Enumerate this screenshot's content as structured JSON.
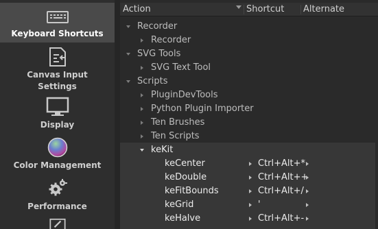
{
  "sidebar": {
    "items": [
      {
        "label": "Keyboard Shortcuts",
        "icon": "keyboard-icon",
        "active": true
      },
      {
        "label": "Canvas Input Settings",
        "icon": "canvas-input-icon",
        "active": false
      },
      {
        "label": "Display",
        "icon": "monitor-icon",
        "active": false
      },
      {
        "label": "Color Management",
        "icon": "color-wheel-icon",
        "active": false
      },
      {
        "label": "Performance",
        "icon": "gears-icon",
        "active": false
      },
      {
        "label": "",
        "icon": "pencil-icon",
        "active": false
      }
    ]
  },
  "table": {
    "columns": {
      "action": "Action",
      "shortcut": "Shortcut",
      "alternate": "Alternate"
    },
    "rows": [
      {
        "text": "Recorder"
      },
      {
        "text": "Recorder"
      },
      {
        "text": "SVG Tools"
      },
      {
        "text": "SVG Text Tool"
      },
      {
        "text": "Scripts"
      },
      {
        "text": "PluginDevTools"
      },
      {
        "text": "Python Plugin Importer"
      },
      {
        "text": "Ten Brushes"
      },
      {
        "text": "Ten Scripts"
      },
      {
        "text": "keKit"
      },
      {
        "text": "keCenter",
        "shortcut": "Ctrl+Alt+*"
      },
      {
        "text": "keDouble",
        "shortcut": "Ctrl+Alt++"
      },
      {
        "text": "keFitBounds",
        "shortcut": "Ctrl+Alt+/"
      },
      {
        "text": "keGrid",
        "shortcut": "'"
      },
      {
        "text": "keHalve",
        "shortcut": "Ctrl+Alt+-"
      }
    ]
  },
  "colors": {
    "active_sidebar": "#4a4a4a",
    "selected_block": "#373737",
    "background": "#2a2a2a"
  }
}
